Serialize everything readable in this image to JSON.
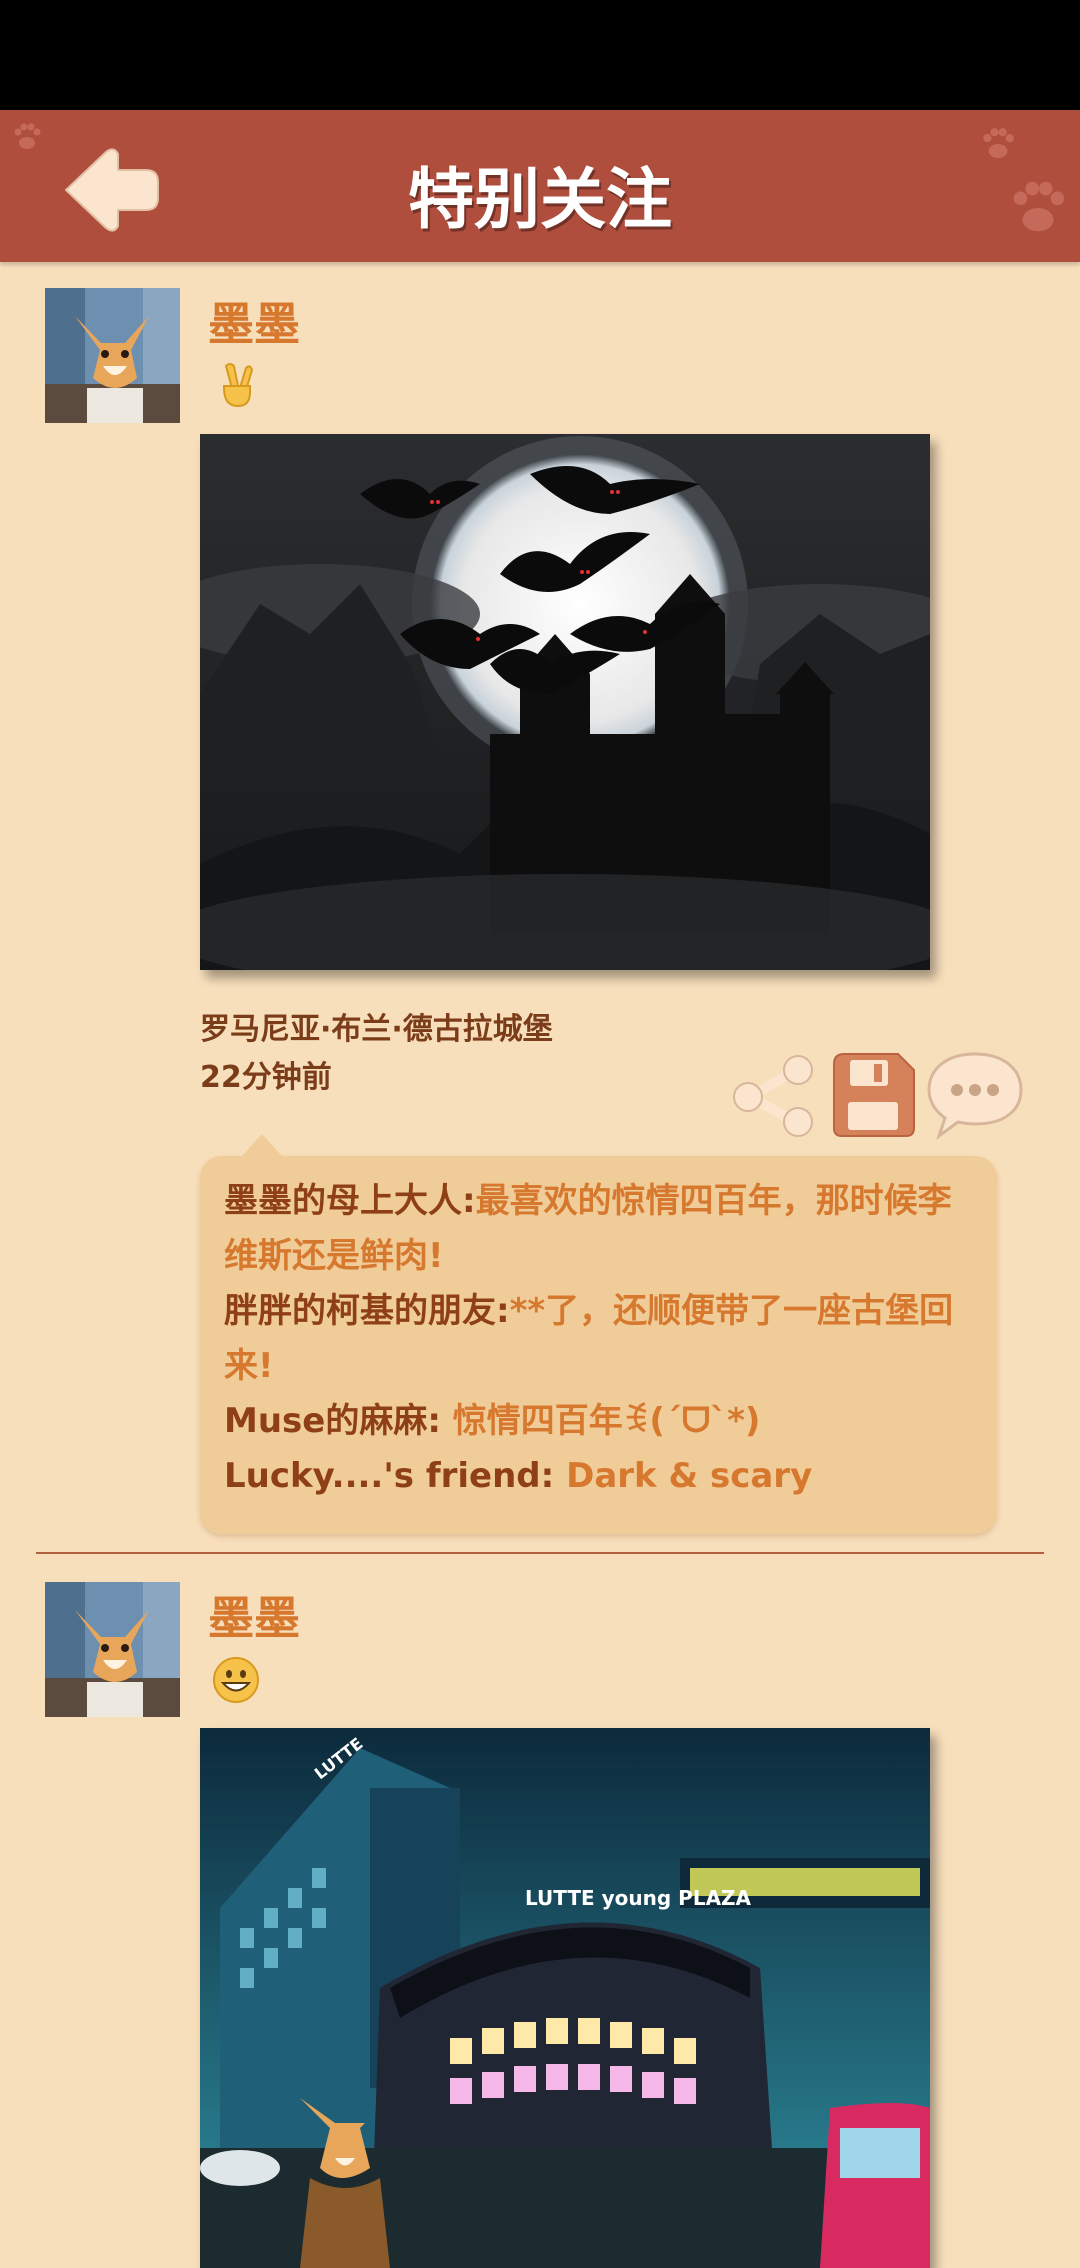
{
  "header": {
    "title": "特别关注"
  },
  "posts": [
    {
      "username": "墨墨",
      "emoji": "✌️",
      "image_subject": "castle with bats under full moon",
      "location": "罗马尼亚·布兰·德古拉城堡",
      "time": "22分钟前",
      "comments": [
        {
          "author": "墨墨的母上大人:",
          "text": "最喜欢的惊情四百年，那时候李维斯还是鲜肉!"
        },
        {
          "author": "胖胖的柯基的朋友:",
          "text": "**了，还顺便带了一座古堡回来!"
        },
        {
          "author": "Muse的麻麻:",
          "text": "惊情四百年ꉂ(ˊᗜˋ*)"
        },
        {
          "author": "Lucky....'s friend:",
          "text": "Dark & scary"
        }
      ]
    },
    {
      "username": "墨墨",
      "emoji": "😀",
      "image_subject": "city shopping mall at night with corgi",
      "image_signs": {
        "mall": "LUTTE young PLAZA",
        "tower": "LUTTE"
      }
    }
  ],
  "actions": [
    "share-icon",
    "save-icon",
    "comment-icon"
  ],
  "colors": {
    "header": "#b04e3e",
    "background": "#f8dfbc",
    "accent": "#d7782f",
    "author": "#8e3f15",
    "bubble": "#f0cd98"
  }
}
